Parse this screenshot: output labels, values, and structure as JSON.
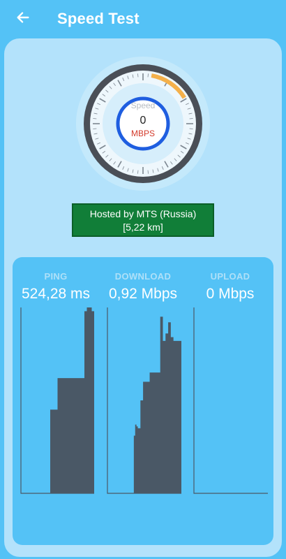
{
  "app": {
    "title": "Speed Test"
  },
  "gauge": {
    "label": "Speed",
    "value": "0",
    "unit": "MBPS",
    "colors": {
      "ring": "#4a4f57",
      "inner": "#1f5ee0",
      "arc": "#f4b04a",
      "unit": "#d33a2a"
    }
  },
  "server": {
    "line1": "Hosted by MTS (Russia)",
    "line2": "[5,22 km]"
  },
  "results": [
    {
      "label": "PING",
      "value": "524,28 ms"
    },
    {
      "label": "DOWNLOAD",
      "value": "0,92 Mbps"
    },
    {
      "label": "UPLOAD",
      "value": "0 Mbps"
    }
  ],
  "graphs": {
    "color": "#4a5866",
    "ping": [
      0,
      0,
      0,
      0,
      0,
      0,
      0,
      0,
      0,
      0,
      0,
      0,
      0.45,
      0.45,
      0.45,
      0.62,
      0.62,
      0.62,
      0.62,
      0.62,
      0.62,
      0.62,
      0.62,
      0.62,
      0.62,
      0.62,
      0.98,
      1.0,
      1.0,
      0.98
    ],
    "download": [
      0,
      0,
      0,
      0,
      0,
      0,
      0,
      0,
      0,
      0,
      0,
      0,
      0,
      0,
      0,
      0,
      0,
      0,
      0,
      0,
      0.31,
      0.37,
      0.36,
      0.35,
      0.35,
      0.5,
      0.5,
      0.6,
      0.6,
      0.6,
      0.6,
      0.6,
      0.65,
      0.65,
      0.65,
      0.65,
      0.65,
      0.65,
      0.65,
      0.65,
      0.95,
      0.95,
      0.82,
      0.82,
      0.86,
      0.86,
      0.92,
      0.92,
      0.84,
      0.84,
      0.82,
      0.82,
      0.82,
      0.82,
      0.82,
      0.82
    ],
    "upload": [
      0,
      0,
      0,
      0,
      0,
      0,
      0,
      0,
      0,
      0
    ]
  }
}
